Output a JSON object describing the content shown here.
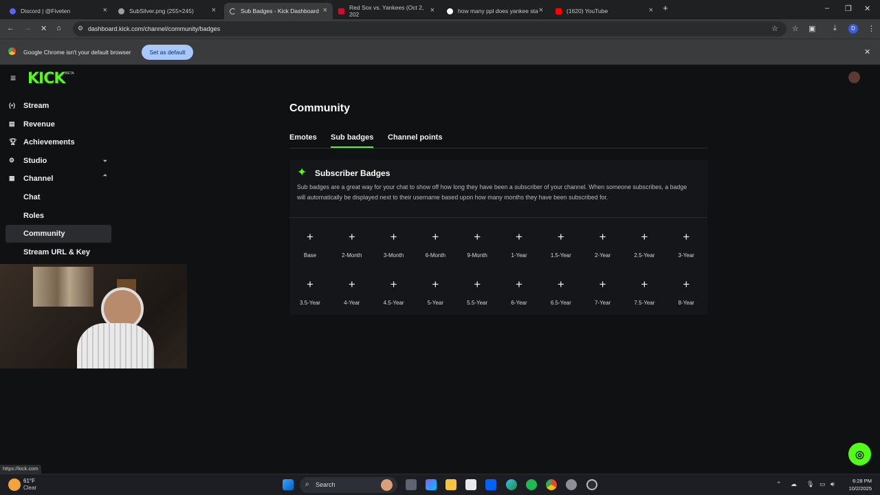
{
  "browser": {
    "tabs": [
      {
        "title": "Discord | @Fiveten",
        "color": "#5865f2",
        "active": false
      },
      {
        "title": "SubSilver.png (255×245)",
        "color": "#9aa0a6",
        "active": false
      },
      {
        "title": "Sub Badges - Kick Dashboard",
        "color": "#e8e8e8",
        "active": true
      },
      {
        "title": "Red Sox vs. Yankees (Oct 2, 202",
        "color": "#c8102e",
        "active": false
      },
      {
        "title": "how many ppl does yankee sta",
        "color": "#ffffff",
        "active": false
      },
      {
        "title": "(1620) YouTube",
        "color": "#ff0000",
        "active": false
      }
    ],
    "url": "dashboard.kick.com/channel/community/badges",
    "infobar": {
      "message": "Google Chrome isn't your default browser",
      "button": "Set as default"
    },
    "status_url": "https://kick.com"
  },
  "brand": {
    "logo": "KICK",
    "beta": "BETA",
    "accent": "#53fc18"
  },
  "sidebar": {
    "items": [
      {
        "label": "Stream",
        "icon": "broadcast-icon"
      },
      {
        "label": "Revenue",
        "icon": "chart-icon"
      },
      {
        "label": "Achievements",
        "icon": "trophy-icon"
      },
      {
        "label": "Studio",
        "icon": "gear-icon",
        "chevron": "down"
      },
      {
        "label": "Channel",
        "icon": "film-icon",
        "chevron": "up"
      },
      {
        "label": "Chat"
      },
      {
        "label": "Roles"
      },
      {
        "label": "Community",
        "active": true
      },
      {
        "label": "Stream URL & Key"
      }
    ]
  },
  "main": {
    "title": "Community",
    "tabs": [
      "Emotes",
      "Sub badges",
      "Channel points"
    ],
    "active_tab": "Sub badges",
    "panel": {
      "title": "Subscriber Badges",
      "description": "Sub badges are a great way for your chat to show off how long they have been a subscriber of your channel. When someone subscribes, a badge will automatically be displayed next to their username based upon how many months they have been subscribed for.",
      "badges_row1": [
        "Base",
        "2-Month",
        "3-Month",
        "6-Month",
        "9-Month",
        "1-Year",
        "1.5-Year",
        "2-Year",
        "2.5-Year",
        "3-Year"
      ],
      "badges_row2": [
        "3.5-Year",
        "4-Year",
        "4.5-Year",
        "5-Year",
        "5.5-Year",
        "6-Year",
        "6.5-Year",
        "7-Year",
        "7.5-Year",
        "8-Year"
      ]
    }
  },
  "taskbar": {
    "weather_temp": "61°F",
    "weather_desc": "Clear",
    "search_placeholder": "Search",
    "time": "6:28 PM",
    "date": "10/2/2025"
  }
}
